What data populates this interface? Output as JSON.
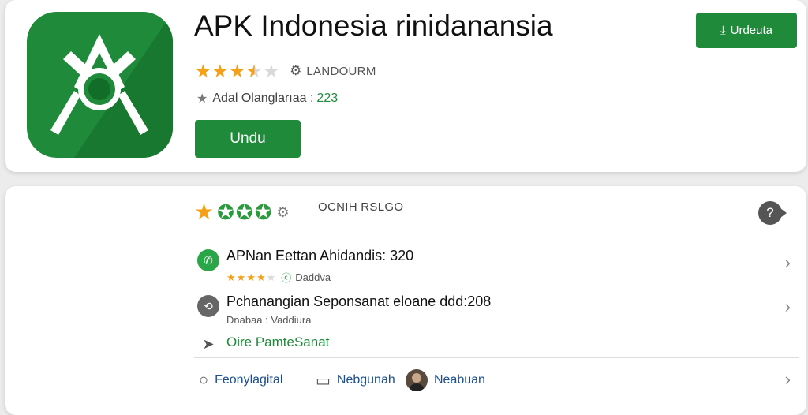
{
  "app": {
    "title": "APK Indonesia rinidanansia",
    "rating_stars": 3.5,
    "developer": "LANDOURM",
    "downloads_label": "Adal Olanglarıaa :",
    "downloads_count": "223",
    "install_label": "Undu",
    "update_label": "Urdeuta"
  },
  "rating_section": {
    "label": "OCNIH RSLGO"
  },
  "list": [
    {
      "title": "APNan Eettan Ahidandis: 320",
      "subtitle": "Daddva",
      "stars": 4
    },
    {
      "title": "Pchanangian Seponsanat eloane ddd:208",
      "subtitle": "Dnabaa : Vaddiura"
    }
  ],
  "green_link": "Oire PamteSanat",
  "footer": [
    {
      "label": "Feonylagital",
      "icon": "search-icon"
    },
    {
      "label": "Nebgunah",
      "icon": "comment-icon"
    },
    {
      "label": "Neabuan",
      "icon": "avatar"
    }
  ],
  "colors": {
    "brand_green": "#1e8a3a",
    "star_gold": "#f4a11a",
    "link_blue": "#1b4f8f"
  }
}
